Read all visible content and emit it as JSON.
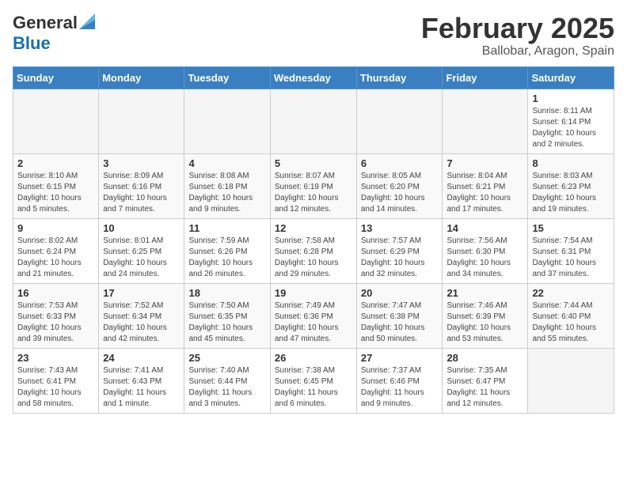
{
  "header": {
    "logo_general": "General",
    "logo_blue": "Blue",
    "month_title": "February 2025",
    "location": "Ballobar, Aragon, Spain"
  },
  "days_of_week": [
    "Sunday",
    "Monday",
    "Tuesday",
    "Wednesday",
    "Thursday",
    "Friday",
    "Saturday"
  ],
  "weeks": [
    [
      {
        "day": "",
        "info": ""
      },
      {
        "day": "",
        "info": ""
      },
      {
        "day": "",
        "info": ""
      },
      {
        "day": "",
        "info": ""
      },
      {
        "day": "",
        "info": ""
      },
      {
        "day": "",
        "info": ""
      },
      {
        "day": "1",
        "info": "Sunrise: 8:11 AM\nSunset: 6:14 PM\nDaylight: 10 hours and 2 minutes."
      }
    ],
    [
      {
        "day": "2",
        "info": "Sunrise: 8:10 AM\nSunset: 6:15 PM\nDaylight: 10 hours and 5 minutes."
      },
      {
        "day": "3",
        "info": "Sunrise: 8:09 AM\nSunset: 6:16 PM\nDaylight: 10 hours and 7 minutes."
      },
      {
        "day": "4",
        "info": "Sunrise: 8:08 AM\nSunset: 6:18 PM\nDaylight: 10 hours and 9 minutes."
      },
      {
        "day": "5",
        "info": "Sunrise: 8:07 AM\nSunset: 6:19 PM\nDaylight: 10 hours and 12 minutes."
      },
      {
        "day": "6",
        "info": "Sunrise: 8:05 AM\nSunset: 6:20 PM\nDaylight: 10 hours and 14 minutes."
      },
      {
        "day": "7",
        "info": "Sunrise: 8:04 AM\nSunset: 6:21 PM\nDaylight: 10 hours and 17 minutes."
      },
      {
        "day": "8",
        "info": "Sunrise: 8:03 AM\nSunset: 6:23 PM\nDaylight: 10 hours and 19 minutes."
      }
    ],
    [
      {
        "day": "9",
        "info": "Sunrise: 8:02 AM\nSunset: 6:24 PM\nDaylight: 10 hours and 21 minutes."
      },
      {
        "day": "10",
        "info": "Sunrise: 8:01 AM\nSunset: 6:25 PM\nDaylight: 10 hours and 24 minutes."
      },
      {
        "day": "11",
        "info": "Sunrise: 7:59 AM\nSunset: 6:26 PM\nDaylight: 10 hours and 26 minutes."
      },
      {
        "day": "12",
        "info": "Sunrise: 7:58 AM\nSunset: 6:28 PM\nDaylight: 10 hours and 29 minutes."
      },
      {
        "day": "13",
        "info": "Sunrise: 7:57 AM\nSunset: 6:29 PM\nDaylight: 10 hours and 32 minutes."
      },
      {
        "day": "14",
        "info": "Sunrise: 7:56 AM\nSunset: 6:30 PM\nDaylight: 10 hours and 34 minutes."
      },
      {
        "day": "15",
        "info": "Sunrise: 7:54 AM\nSunset: 6:31 PM\nDaylight: 10 hours and 37 minutes."
      }
    ],
    [
      {
        "day": "16",
        "info": "Sunrise: 7:53 AM\nSunset: 6:33 PM\nDaylight: 10 hours and 39 minutes."
      },
      {
        "day": "17",
        "info": "Sunrise: 7:52 AM\nSunset: 6:34 PM\nDaylight: 10 hours and 42 minutes."
      },
      {
        "day": "18",
        "info": "Sunrise: 7:50 AM\nSunset: 6:35 PM\nDaylight: 10 hours and 45 minutes."
      },
      {
        "day": "19",
        "info": "Sunrise: 7:49 AM\nSunset: 6:36 PM\nDaylight: 10 hours and 47 minutes."
      },
      {
        "day": "20",
        "info": "Sunrise: 7:47 AM\nSunset: 6:38 PM\nDaylight: 10 hours and 50 minutes."
      },
      {
        "day": "21",
        "info": "Sunrise: 7:46 AM\nSunset: 6:39 PM\nDaylight: 10 hours and 53 minutes."
      },
      {
        "day": "22",
        "info": "Sunrise: 7:44 AM\nSunset: 6:40 PM\nDaylight: 10 hours and 55 minutes."
      }
    ],
    [
      {
        "day": "23",
        "info": "Sunrise: 7:43 AM\nSunset: 6:41 PM\nDaylight: 10 hours and 58 minutes."
      },
      {
        "day": "24",
        "info": "Sunrise: 7:41 AM\nSunset: 6:43 PM\nDaylight: 11 hours and 1 minute."
      },
      {
        "day": "25",
        "info": "Sunrise: 7:40 AM\nSunset: 6:44 PM\nDaylight: 11 hours and 3 minutes."
      },
      {
        "day": "26",
        "info": "Sunrise: 7:38 AM\nSunset: 6:45 PM\nDaylight: 11 hours and 6 minutes."
      },
      {
        "day": "27",
        "info": "Sunrise: 7:37 AM\nSunset: 6:46 PM\nDaylight: 11 hours and 9 minutes."
      },
      {
        "day": "28",
        "info": "Sunrise: 7:35 AM\nSunset: 6:47 PM\nDaylight: 11 hours and 12 minutes."
      },
      {
        "day": "",
        "info": ""
      }
    ]
  ]
}
